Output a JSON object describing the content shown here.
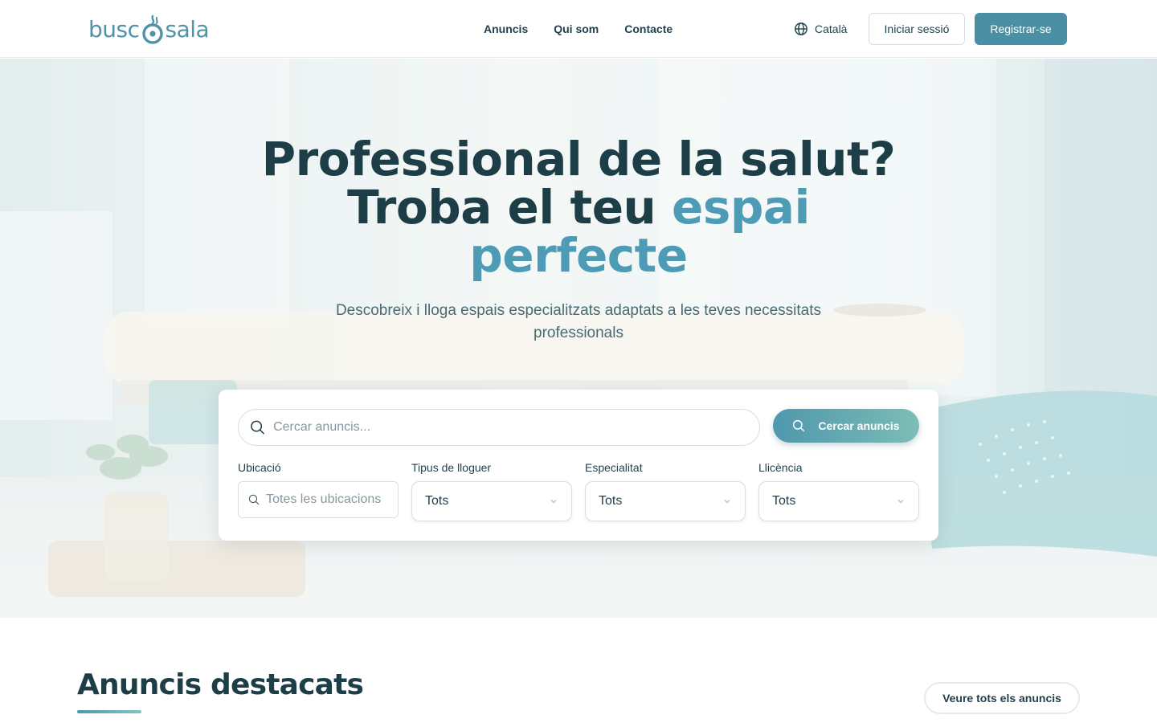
{
  "brand": {
    "logo_text_left": "busc",
    "logo_text_right": "sala",
    "color": "#4e93a8"
  },
  "nav": {
    "items": [
      {
        "label": "Anuncis"
      },
      {
        "label": "Qui som"
      },
      {
        "label": "Contacte"
      }
    ]
  },
  "header": {
    "language": "Català",
    "login_label": "Iniciar sessió",
    "register_label": "Registrar-se"
  },
  "hero": {
    "title_line1": "Professional de la salut?",
    "title_line2_plain": "Troba el teu ",
    "title_line2_accent": "espai",
    "title_line3_accent": "perfecte",
    "subtitle": "Descobreix i lloga espais especialitzats adaptats a les teves necessitats professionals",
    "accent_color": "#4e9bb5"
  },
  "search": {
    "placeholder": "Cercar anuncis...",
    "button_label": "Cercar anuncis",
    "filters": {
      "location": {
        "label": "Ubicació",
        "placeholder": "Totes les ubicacions"
      },
      "rental_type": {
        "label": "Tipus de lloguer",
        "value": "Tots"
      },
      "specialty": {
        "label": "Especialitat",
        "value": "Tots"
      },
      "license": {
        "label": "Llicència",
        "value": "Tots"
      }
    }
  },
  "featured": {
    "title": "Anuncis destacats",
    "view_all_label": "Veure tots els anuncis"
  },
  "icons": {
    "globe": "globe-icon",
    "search": "search-icon",
    "chevron": "chevron-down-icon"
  }
}
